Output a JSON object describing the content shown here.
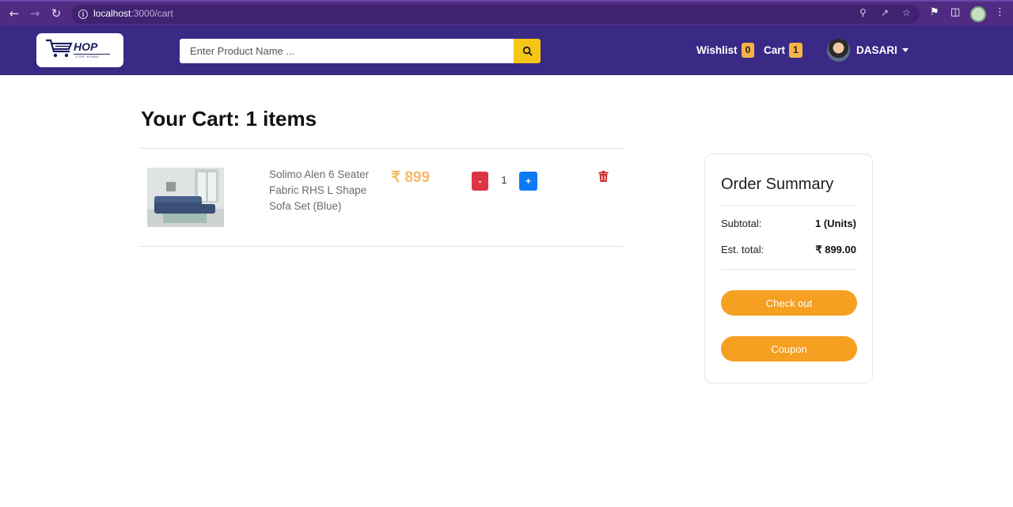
{
  "browser": {
    "url_host": "localhost",
    "url_path": ":3000/cart",
    "back_icon": "arrow-left",
    "forward_icon": "arrow-right",
    "reload_icon": "reload"
  },
  "header": {
    "logo_text": "HOP",
    "logo_subtext": "FOR HOME",
    "search": {
      "placeholder": "Enter Product Name ..."
    },
    "wishlist": {
      "label": "Wishlist",
      "count": "0"
    },
    "cart": {
      "label": "Cart",
      "count": "1"
    },
    "user": {
      "name": "DASARI"
    }
  },
  "cart": {
    "title_prefix": "Your Cart:",
    "title_count": "1 items",
    "items": [
      {
        "name": "Solimo Alen 6 Seater Fabric RHS L Shape Sofa Set (Blue)",
        "price": "₹ 899",
        "quantity": "1",
        "minus_label": "-",
        "plus_label": "+"
      }
    ]
  },
  "summary": {
    "title": "Order Summary",
    "subtotal_label": "Subtotal:",
    "subtotal_value": "1 (Units)",
    "total_label": "Est. total:",
    "total_value": "₹ 899.00",
    "checkout_label": "Check out",
    "coupon_label": "Coupon"
  },
  "colors": {
    "navbar": "#3a2a86",
    "browser_bar": "#4f2c82",
    "accent_orange": "#f5a021",
    "badge": "#f6b346",
    "price": "#f8b96a",
    "minus_button": "#dc3545",
    "plus_button": "#0d7af5"
  }
}
